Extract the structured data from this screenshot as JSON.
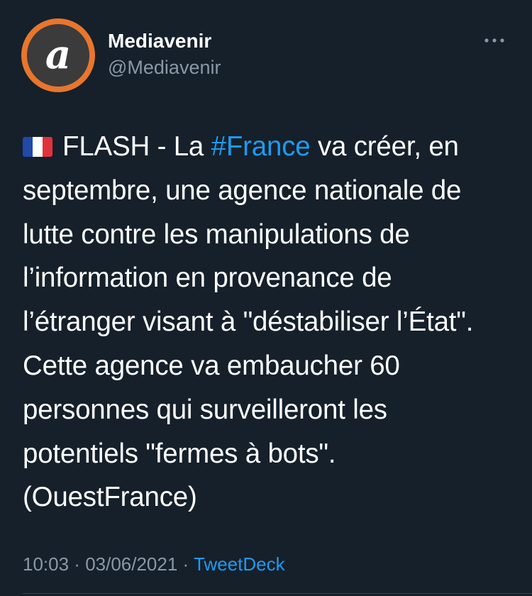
{
  "account": {
    "display_name": "Mediavenir",
    "handle": "@Mediavenir",
    "avatar_letter": "a"
  },
  "tweet": {
    "flag_icon": "france-flag-icon",
    "lines": [
      {
        "part1": "FLASH - La ",
        "hashtag": "#France",
        "part2": " va créer, en"
      },
      "septembre, une agence nationale de",
      "lutte contre les manipulations de",
      "l’information en provenance de",
      "l’étranger visant à \"déstabiliser l’État\".",
      "Cette agence va embaucher 60",
      "personnes qui surveilleront les",
      "potentiels \"fermes à bots\".",
      "(OuestFrance)"
    ]
  },
  "meta": {
    "time": "10:03",
    "separator1": " · ",
    "date": "03/06/2021",
    "separator2": " · ",
    "source": "TweetDeck"
  },
  "colors": {
    "background": "#15202b",
    "link": "#1d9bf0",
    "secondary_text": "#8b98a5",
    "avatar_ring": "#e8762c"
  },
  "icons": {
    "more": "more-horizontal-icon"
  }
}
